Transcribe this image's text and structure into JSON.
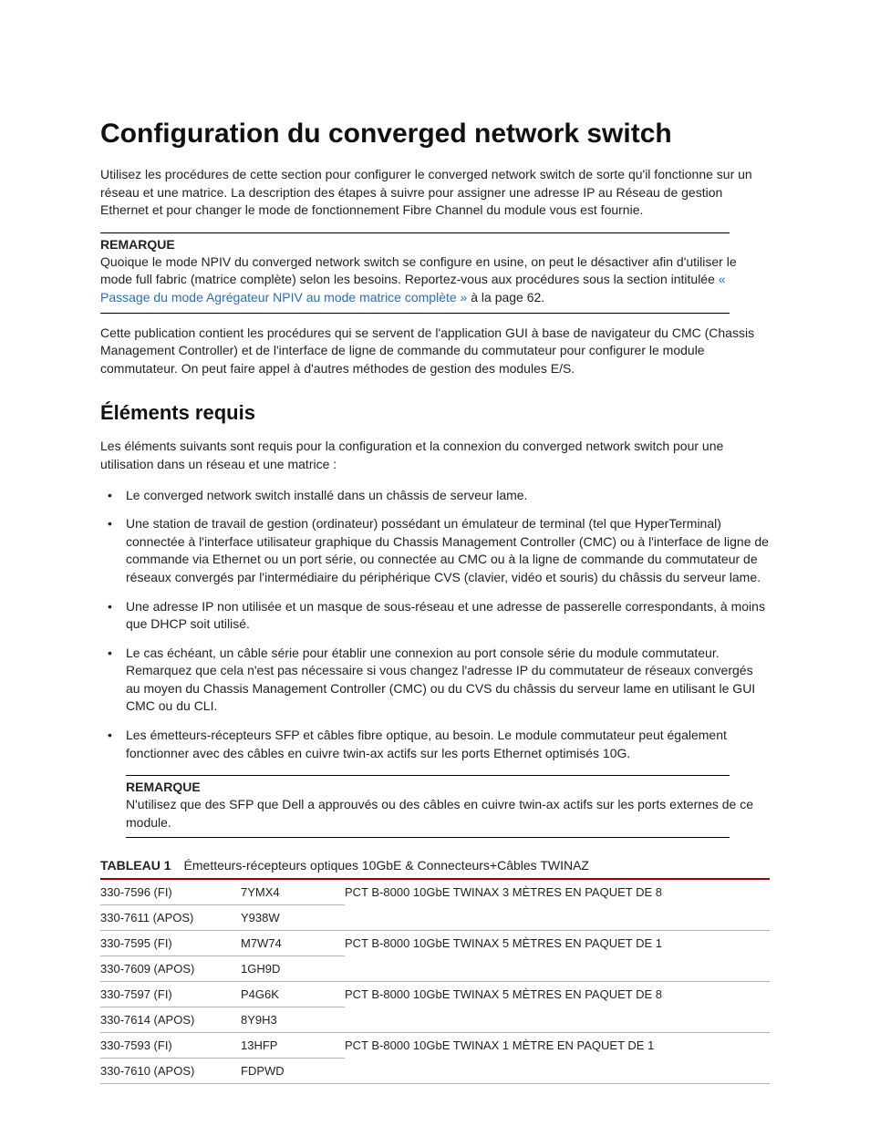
{
  "title": "Configuration du converged network switch",
  "intro_1": "Utilisez les procédures de cette section pour configurer le converged network switch de sorte qu'il fonctionne sur un réseau et une matrice. La description des étapes à suivre pour assigner une adresse IP au Réseau de gestion Ethernet et pour changer le mode de fonctionnement Fibre Channel du module vous est fournie.",
  "note1": {
    "label": "REMARQUE",
    "body_pre": "Quoique le mode NPIV du converged network switch se configure en usine, on peut le désactiver afin d'utiliser le mode full fabric (matrice complète) selon les besoins. Reportez-vous aux procédures sous la section intitulée ",
    "link_text": "« Passage du mode Agrégateur NPIV au mode matrice complète »",
    "body_post": " à la page 62."
  },
  "intro_2": "Cette publication contient les procédures qui se servent de l'application GUI à base de navigateur du CMC (Chassis Management Controller) et de l'interface de ligne de commande du commutateur pour configurer le module commutateur. On peut faire appel à d'autres méthodes de gestion des modules E/S.",
  "section2": {
    "heading": "Éléments requis",
    "intro": "Les éléments suivants sont requis pour la configuration et la connexion du converged network switch pour une utilisation dans un réseau et une matrice :",
    "bullets": [
      "Le converged network switch installé dans un châssis de serveur lame.",
      "Une station de travail de gestion (ordinateur) possédant un émulateur de terminal (tel que HyperTerminal) connectée à l'interface utilisateur graphique du Chassis Management Controller (CMC) ou à l'interface de ligne de commande via Ethernet ou un port série, ou connectée au CMC ou à la ligne de commande du commutateur de réseaux convergés par l'intermédiaire du périphérique CVS (clavier, vidéo et souris) du châssis du serveur lame.",
      "Une adresse IP non utilisée et un masque de sous-réseau et une adresse de passerelle correspondants, à moins que DHCP soit utilisé.",
      "Le cas échéant, un câble série pour établir une connexion au port console série du module commutateur. Remarquez que cela n'est pas nécessaire si vous changez l'adresse IP du commutateur de réseaux convergés au moyen du Chassis Management Controller (CMC) ou du CVS du châssis du serveur lame en utilisant le GUI CMC ou du CLI.",
      "Les émetteurs-récepteurs SFP et câbles fibre optique, au besoin. Le module commutateur peut également fonctionner avec des câbles en cuivre twin-ax actifs sur les ports Ethernet optimisés 10G."
    ],
    "note2": {
      "label": "REMARQUE",
      "body": "N'utilisez que des SFP que Dell a approuvés ou des câbles en cuivre twin-ax actifs sur les ports externes de ce module."
    }
  },
  "table": {
    "label": "TABLEAU 1",
    "caption": "Émetteurs-récepteurs optiques 10GbE & Connecteurs+Câbles TWINAZ",
    "rows": [
      {
        "c1": "330-7596 (FI)",
        "c2": "7YMX4",
        "c3": "PCT B-8000 10GbE TWINAX 3 MÈTRES EN PAQUET DE 8"
      },
      {
        "c1": "330-7611 (APOS)",
        "c2": "Y938W",
        "c3": ""
      },
      {
        "c1": "330-7595 (FI)",
        "c2": "M7W74",
        "c3": "PCT B-8000 10GbE TWINAX 5 MÈTRES EN PAQUET DE 1"
      },
      {
        "c1": "330-7609 (APOS)",
        "c2": "1GH9D",
        "c3": ""
      },
      {
        "c1": "330-7597 (FI)",
        "c2": "P4G6K",
        "c3": "PCT B-8000 10GbE TWINAX 5 MÈTRES EN PAQUET DE 8"
      },
      {
        "c1": "330-7614 (APOS)",
        "c2": "8Y9H3",
        "c3": ""
      },
      {
        "c1": "330-7593 (FI)",
        "c2": "13HFP",
        "c3": "PCT B-8000 10GbE TWINAX 1 MÈTRE EN PAQUET DE 1"
      },
      {
        "c1": "330-7610 (APOS)",
        "c2": "FDPWD",
        "c3": ""
      }
    ]
  }
}
